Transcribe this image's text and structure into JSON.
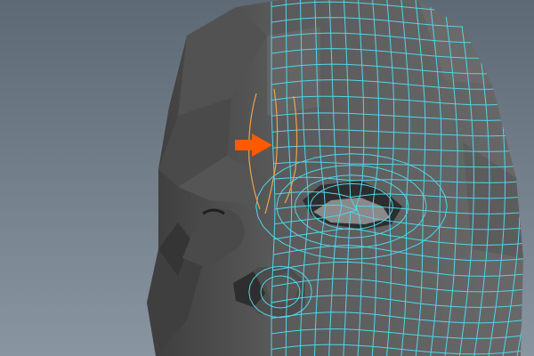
{
  "viewport": {
    "background_top": "#5d6974",
    "background_bottom": "#8995a0"
  },
  "model": {
    "surface_color": "#5e5e5e",
    "surface_light": "#6c6c6c",
    "surface_dark": "#3c3c3c",
    "wireframe_color": "#4fd6ea",
    "selected_edge_color": "#f0a24a"
  },
  "annotation": {
    "icon": "arrow-right-icon",
    "color": "#ff5a00"
  }
}
